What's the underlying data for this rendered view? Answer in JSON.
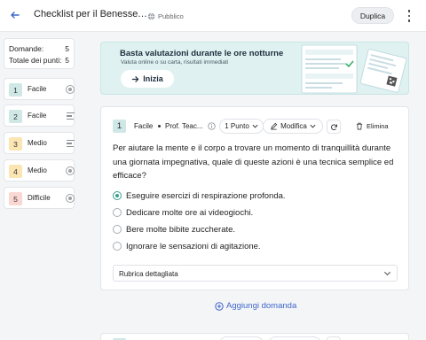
{
  "header": {
    "title": "Checklist per il Benessere",
    "title_ellipsis": "…",
    "visibility": "Pubblico",
    "duplicate_label": "Duplica"
  },
  "summary": {
    "questions_label": "Domande:",
    "questions_value": "5",
    "points_label": "Totale dei punti:",
    "points_value": "5"
  },
  "questions_nav": [
    {
      "number": "1",
      "difficulty": "Facile",
      "type_icon": "radio-icon",
      "color": "#cfe8e6"
    },
    {
      "number": "2",
      "difficulty": "Facile",
      "type_icon": "lines-icon",
      "color": "#cfe8e6"
    },
    {
      "number": "3",
      "difficulty": "Medio",
      "type_icon": "lines-icon",
      "color": "#fbe6b3"
    },
    {
      "number": "4",
      "difficulty": "Medio",
      "type_icon": "radio-icon",
      "color": "#fbe6b3"
    },
    {
      "number": "5",
      "difficulty": "Difficile",
      "type_icon": "radio-icon",
      "color": "#f9d7d2"
    }
  ],
  "promo": {
    "title": "Basta valutazioni durante le ore notturne",
    "subtitle": "Valuta online o su carta, risultati immediati",
    "button_label": "Inizia"
  },
  "question": {
    "number": "1",
    "difficulty": "Facile",
    "author": "Prof. Teac...",
    "points_label": "1 Punto",
    "edit_label": "Modifica",
    "delete_label": "Elimina",
    "text": "Per aiutare la mente e il corpo a trovare un momento di tranquillità durante una giornata impegnativa, quale di queste azioni è una tecnica semplice ed efficace?",
    "options": [
      {
        "label": "Eseguire esercizi di respirazione profonda.",
        "selected": true
      },
      {
        "label": "Dedicare molte ore ai videogiochi.",
        "selected": false
      },
      {
        "label": "Bere molte bibite zuccherate.",
        "selected": false
      },
      {
        "label": "Ignorare le sensazioni di agitazione.",
        "selected": false
      }
    ],
    "rubric_label": "Rubrica dettagliata"
  },
  "add_question_label": "Aggiungi domanda",
  "colors": {
    "accent": "#3a9e8e",
    "link": "#3d66c9",
    "promo_bg": "#dff1f0"
  }
}
